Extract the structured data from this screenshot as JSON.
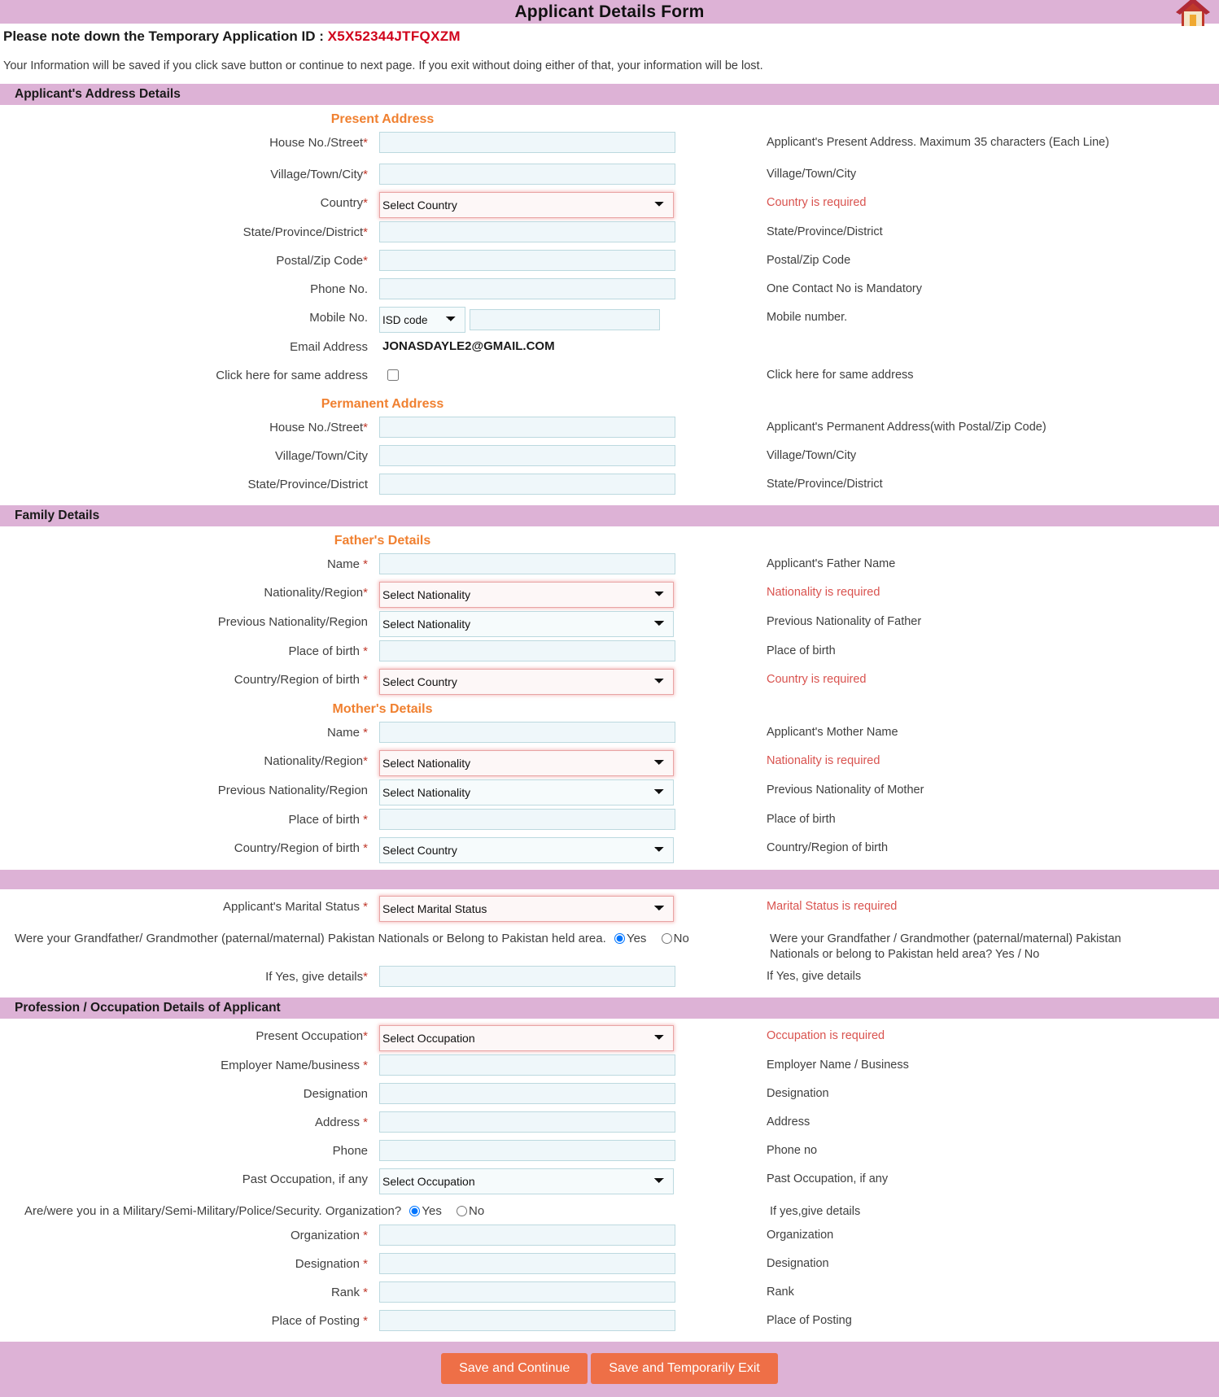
{
  "header": {
    "title": "Applicant Details Form",
    "home_icon": "home-icon"
  },
  "notices": {
    "temp_id_label": "Please note down the Temporary Application ID : ",
    "temp_id_value": "X5X52344JTFQXZM",
    "save_warning": "Your Information will be saved if you click save button or continue to next page. If you exit without doing either of that, your information will be lost."
  },
  "sections": {
    "address": "Applicant's Address Details",
    "family": "Family Details",
    "marital_blank": "",
    "profession": "Profession / Occupation Details of Applicant"
  },
  "present_address": {
    "heading": "Present Address",
    "rows": [
      {
        "label": "House No./Street",
        "required": true,
        "help": "Applicant's Present Address. Maximum 35 characters (Each Line)",
        "help_error": false
      },
      {
        "label": "Village/Town/City",
        "required": true,
        "help": "Village/Town/City",
        "help_error": false
      },
      {
        "label": "Country",
        "required": true,
        "help": "Country is required",
        "help_error": true,
        "select_value": "Select Country"
      },
      {
        "label": "State/Province/District",
        "required": true,
        "help": "State/Province/District",
        "help_error": false
      },
      {
        "label": "Postal/Zip Code",
        "required": true,
        "help": "Postal/Zip Code",
        "help_error": false
      },
      {
        "label": "Phone No.",
        "required": false,
        "help": "One Contact No is Mandatory",
        "help_error": false
      },
      {
        "label": "Mobile No.",
        "required": false,
        "help": "Mobile number.",
        "help_error": false,
        "isd_value": "ISD code"
      }
    ],
    "email_label": "Email Address",
    "email_value": "JONASDAYLE2@GMAIL.COM",
    "same_address_label": "Click here for same address",
    "same_address_help": "Click here for same address",
    "same_address_checked": false
  },
  "permanent_address": {
    "heading": "Permanent Address",
    "rows": [
      {
        "label": "House No./Street",
        "required": true,
        "help": "Applicant's Permanent Address(with Postal/Zip Code)"
      },
      {
        "label": "Village/Town/City",
        "required": false,
        "help": "Village/Town/City"
      },
      {
        "label": "State/Province/District",
        "required": false,
        "help": "State/Province/District"
      }
    ]
  },
  "father": {
    "heading": "Father's Details",
    "rows": [
      {
        "label": "Name ",
        "required": true,
        "type": "text",
        "help": "Applicant's Father Name",
        "help_error": false
      },
      {
        "label": "Nationality/Region",
        "required": true,
        "type": "select",
        "value": "Select Nationality",
        "invalid": true,
        "help": "Nationality is required",
        "help_error": true
      },
      {
        "label": "Previous Nationality/Region",
        "required": false,
        "type": "select",
        "value": "Select Nationality",
        "invalid": false,
        "help": "Previous Nationality of Father",
        "help_error": false
      },
      {
        "label": "Place of birth ",
        "required": true,
        "type": "text",
        "help": "Place of birth",
        "help_error": false
      },
      {
        "label": "Country/Region of birth ",
        "required": true,
        "type": "select",
        "value": "Select Country",
        "invalid": true,
        "help": "Country is required",
        "help_error": true
      }
    ]
  },
  "mother": {
    "heading": "Mother's Details",
    "rows": [
      {
        "label": "Name ",
        "required": true,
        "type": "text",
        "help": "Applicant's Mother Name",
        "help_error": false
      },
      {
        "label": "Nationality/Region",
        "required": true,
        "type": "select",
        "value": "Select Nationality",
        "invalid": true,
        "help": "Nationality is required",
        "help_error": true
      },
      {
        "label": "Previous Nationality/Region",
        "required": false,
        "type": "select",
        "value": "Select Nationality",
        "invalid": false,
        "help": "Previous Nationality of Mother",
        "help_error": false
      },
      {
        "label": "Place of birth ",
        "required": true,
        "type": "text",
        "help": "Place of birth",
        "help_error": false
      },
      {
        "label": "Country/Region of birth ",
        "required": true,
        "type": "select",
        "value": "Select Country",
        "invalid": false,
        "help": "Country/Region of birth",
        "help_error": false
      }
    ]
  },
  "marital": {
    "label": "Applicant's Marital Status ",
    "required": true,
    "value": "Select Marital Status",
    "help": "Marital Status is required",
    "pakistan_question": "Were your Grandfather/ Grandmother (paternal/maternal) Pakistan Nationals or Belong to Pakistan held area.",
    "pakistan_help": "Were your Grandfather / Grandmother (paternal/maternal) Pakistan Nationals or belong to Pakistan held area? Yes / No",
    "yes_label": "Yes",
    "no_label": "No",
    "selected": "Yes",
    "details_label": "If Yes, give details",
    "details_required": true,
    "details_help": "If Yes, give details"
  },
  "profession": {
    "rows": [
      {
        "label": "Present Occupation",
        "required": true,
        "type": "select",
        "value": "Select Occupation",
        "invalid": true,
        "help": "Occupation is required",
        "help_error": true
      },
      {
        "label": "Employer Name/business ",
        "required": true,
        "type": "text",
        "help": "Employer Name / Business",
        "help_error": false
      },
      {
        "label": "Designation",
        "required": false,
        "type": "text",
        "help": "Designation",
        "help_error": false
      },
      {
        "label": "Address ",
        "required": true,
        "type": "text",
        "help": "Address",
        "help_error": false
      },
      {
        "label": "Phone",
        "required": false,
        "type": "text",
        "help": "Phone no",
        "help_error": false
      },
      {
        "label": "Past Occupation, if any",
        "required": false,
        "type": "select",
        "value": "Select Occupation",
        "invalid": false,
        "help": "Past Occupation, if any",
        "help_error": false
      }
    ],
    "military_question": "Are/were you in a Military/Semi-Military/Police/Security. Organization?",
    "military_help": "If yes,give details",
    "yes_label": "Yes",
    "no_label": "No",
    "selected": "Yes",
    "military_rows": [
      {
        "label": "Organization ",
        "required": true,
        "help": "Organization"
      },
      {
        "label": "Designation ",
        "required": true,
        "help": "Designation"
      },
      {
        "label": "Rank ",
        "required": true,
        "help": "Rank"
      },
      {
        "label": "Place of Posting ",
        "required": true,
        "help": "Place of Posting"
      }
    ]
  },
  "footer": {
    "save_continue": "Save and Continue",
    "save_exit": "Save and Temporarily Exit"
  }
}
